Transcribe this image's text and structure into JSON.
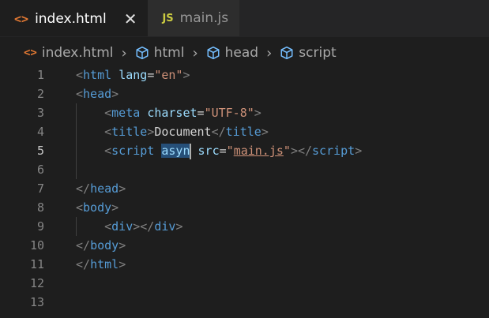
{
  "tabs": [
    {
      "icon": "<>",
      "label": "index.html",
      "active": true,
      "close": "✕"
    },
    {
      "icon": "JS",
      "label": "main.js",
      "active": false
    }
  ],
  "breadcrumb": [
    {
      "icon": "html-file-icon",
      "label": "index.html"
    },
    {
      "icon": "cube-icon",
      "label": "html"
    },
    {
      "icon": "cube-icon",
      "label": "head"
    },
    {
      "icon": "cube-icon",
      "label": "script"
    }
  ],
  "breadcrumb_sep": "›",
  "editor": {
    "current_line": 5,
    "lines": [
      {
        "n": "1"
      },
      {
        "n": "2"
      },
      {
        "n": "3"
      },
      {
        "n": "4"
      },
      {
        "n": "5"
      },
      {
        "n": "6"
      },
      {
        "n": "7"
      },
      {
        "n": "8"
      },
      {
        "n": "9"
      },
      {
        "n": "10"
      },
      {
        "n": "11"
      },
      {
        "n": "12"
      },
      {
        "n": "13"
      }
    ],
    "tokens": {
      "html": "html",
      "lang": "lang",
      "en": "\"en\"",
      "head": "head",
      "meta": "meta",
      "charset": "charset",
      "utf8": "\"UTF-8\"",
      "title": "title",
      "document": "Document",
      "script": "script",
      "asyn": "asyn",
      "src": "src",
      "mainjs": "main.js",
      "body": "body",
      "div": "div"
    }
  },
  "colors": {
    "tag": "#569cd6",
    "attr": "#9cdcfe",
    "string": "#ce9178",
    "selection": "#264f78"
  }
}
